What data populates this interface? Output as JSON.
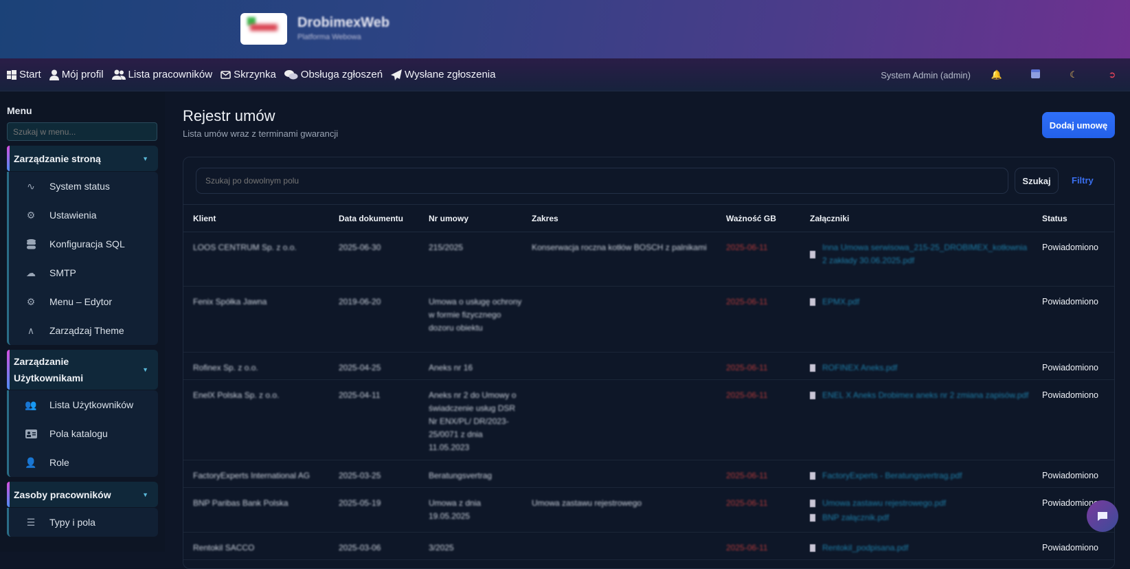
{
  "brand": {
    "title": "DrobimexWeb",
    "subtitle": "Platforma Webowa"
  },
  "nav": {
    "items": [
      {
        "label": "Start",
        "icon": "windows-icon"
      },
      {
        "label": "Mój profil",
        "icon": "user-icon"
      },
      {
        "label": "Lista pracowników",
        "icon": "users-icon"
      },
      {
        "label": "Skrzynka",
        "icon": "envelope-icon"
      },
      {
        "label": "Obsługa zgłoszeń",
        "icon": "comments-icon"
      },
      {
        "label": "Wysłane zgłoszenia",
        "icon": "paper-plane-icon"
      }
    ],
    "user": "System Admin (admin)"
  },
  "sidebar": {
    "title": "Menu",
    "search_placeholder": "Szukaj w menu...",
    "groups": [
      {
        "label": "Zarządzanie stroną",
        "items": [
          "System status",
          "Ustawienia",
          "Konfiguracja SQL",
          "SMTP",
          "Menu – Edytor",
          "Zarządzaj Theme"
        ]
      },
      {
        "label": "Zarządzanie Użytkownikami",
        "items": [
          "Lista Użytkowników",
          "Pola katalogu",
          "Role"
        ]
      },
      {
        "label": "Zasoby pracowników",
        "items": [
          "Typy i pola"
        ]
      }
    ]
  },
  "page": {
    "title": "Rejestr umów",
    "subtitle": "Lista umów wraz z terminami gwarancji",
    "add_button": "Dodaj umowę",
    "search_placeholder": "Szukaj po dowolnym polu",
    "search_button": "Szukaj",
    "filters": "Filtry"
  },
  "table": {
    "headers": [
      "Klient",
      "Data dokumentu",
      "Nr umowy",
      "Zakres",
      "Ważność GB",
      "Załączniki",
      "Status"
    ],
    "rows": [
      {
        "client": "LOOS CENTRUM Sp. z o.o.",
        "date": "2025-06-30",
        "number": "215/2025",
        "scope": "Konserwacja roczna kotłów BOSCH z palnikami",
        "warranty": "2025-06-11",
        "attachments": [
          "Inna Umowa serwisowa_215-25_DROBIMEX_kotłownia 2 zakłady 30.06.2025.pdf"
        ],
        "status": "Powiadomiono"
      },
      {
        "client": "Fenix Spółka Jawna",
        "date": "2019-06-20",
        "number": "Umowa o usługę ochrony w formie fizycznego dozoru obiektu",
        "scope": "",
        "warranty": "2025-06-11",
        "attachments": [
          "EPMX.pdf"
        ],
        "status": "Powiadomiono"
      },
      {
        "client": "Rofinex Sp. z o.o.",
        "date": "2025-04-25",
        "number": "Aneks nr 16",
        "scope": "",
        "warranty": "2025-06-11",
        "attachments": [
          "ROFINEX Aneks.pdf"
        ],
        "status": "Powiadomiono"
      },
      {
        "client": "EnelX Polska Sp. z o.o.",
        "date": "2025-04-11",
        "number": "Aneks nr 2 do Umowy o świadczenie usług DSR Nr ENX/PL/ DR/2023-25/0071 z dnia 11.05.2023",
        "scope": "",
        "warranty": "2025-06-11",
        "attachments": [
          "ENEL X Aneks Drobimex aneks nr 2 zmiana zapisów.pdf"
        ],
        "status": "Powiadomiono"
      },
      {
        "client": "FactoryExperts International AG",
        "date": "2025-03-25",
        "number": "Beratungsvertrag",
        "scope": "",
        "warranty": "2025-06-11",
        "attachments": [
          "FactoryExperts - Beratungsvertrag.pdf"
        ],
        "status": "Powiadomiono"
      },
      {
        "client": "BNP Paribas Bank Polska",
        "date": "2025-05-19",
        "number": "Umowa z dnia 19.05.2025",
        "scope": "Umowa zastawu rejestrowego",
        "warranty": "2025-06-11",
        "attachments": [
          "Umowa zastawu rejestrowego.pdf",
          "BNP załącznik.pdf"
        ],
        "status": "Powiadomiono"
      },
      {
        "client": "Rentokil SACCO",
        "date": "2025-03-06",
        "number": "3/2025",
        "scope": "",
        "warranty": "2025-06-11",
        "attachments": [
          "Rentokil_podpisana.pdf"
        ],
        "status": "Powiadomiono"
      }
    ]
  },
  "colors": {
    "accent": "#2f6ff8",
    "danger": "#b33a3a",
    "link": "#1e7ea8"
  }
}
